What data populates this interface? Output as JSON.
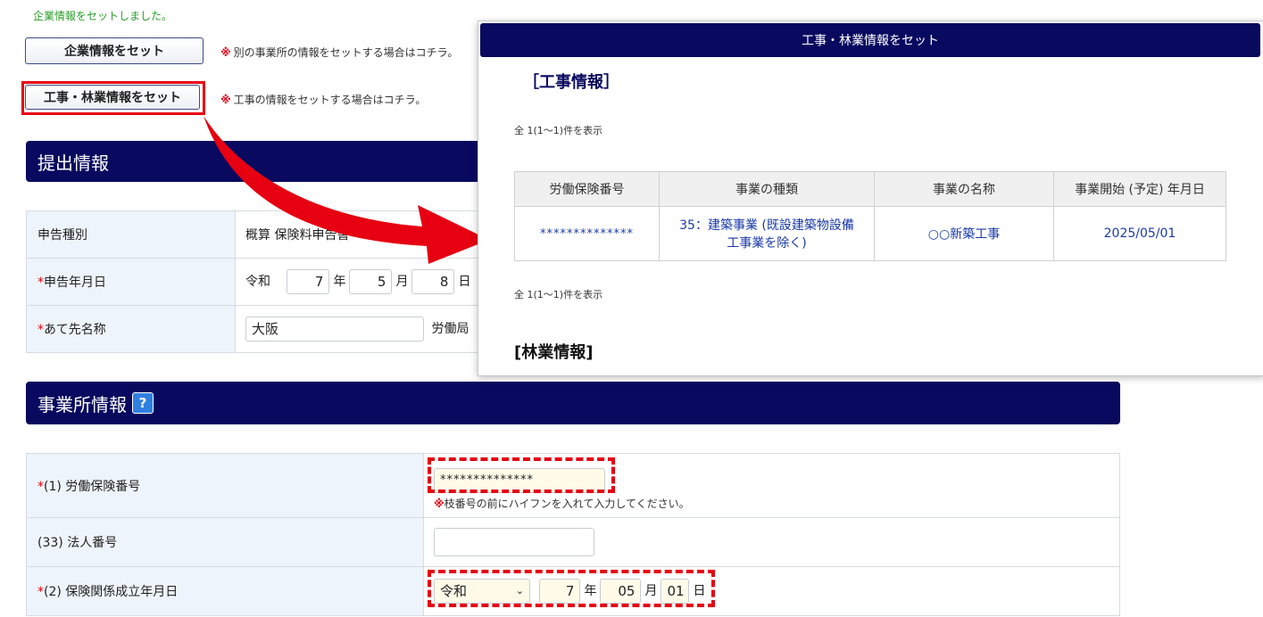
{
  "top_message": "企業情報をセットしました。",
  "buttons": {
    "set_company": "企業情報をセット",
    "set_work": "工事・林業情報をセット"
  },
  "notes": {
    "mark": "※",
    "company": "別の事業所の情報をセットする場合はコチラ。",
    "work": "工事の情報をセットする場合はコチラ。"
  },
  "submission": {
    "title": "提出情報",
    "rows": {
      "type_label": "申告種別",
      "type_value": "概算 保険料申告書",
      "date_label": "申告年月日",
      "era": "令和",
      "year": "7",
      "year_unit": "年",
      "month": "5",
      "month_unit": "月",
      "day": "8",
      "day_unit": "日",
      "dest_label": "あて先名称",
      "dest_value": "大阪",
      "dest_suffix": "労働局"
    }
  },
  "office": {
    "title": "事業所情報",
    "help": "?",
    "rows": {
      "insurance_no_label": "(1) 労働保険番号",
      "insurance_no_value": "**************",
      "insurance_no_hint": "枝番号の前にハイフンを入れて入力してください。",
      "corp_no_label": "(33) 法人番号",
      "corp_no_value": "",
      "established_label": "(2) 保険関係成立年月日",
      "era": "令和",
      "year": "7",
      "month": "05",
      "day": "01",
      "year_unit": "年",
      "month_unit": "月",
      "day_unit": "日"
    }
  },
  "required_mark": "*",
  "popup": {
    "title": "工事・林業情報をセット",
    "work_heading": "［工事情報］",
    "count_text": "全 1(1～1)件を表示",
    "columns": [
      "労働保険番号",
      "事業の種類",
      "事業の名称",
      "事業開始 (予定) 年月日"
    ],
    "rows": [
      {
        "insurance_no": "**************",
        "business_type_1": "35：建築事業 (既設建築物設備",
        "business_type_2": "工事業を除く)",
        "name": "○○新築工事",
        "start_date": "2025/05/01"
      }
    ],
    "forest_heading": "[林業情報]"
  },
  "colors": {
    "navy": "#08095f",
    "highlight_red": "#e60012",
    "link_blue": "#1a3aa8"
  }
}
